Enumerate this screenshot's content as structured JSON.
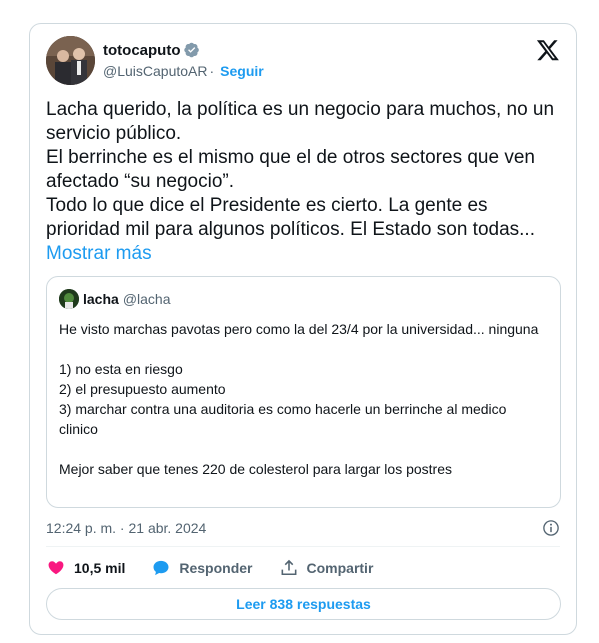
{
  "author": {
    "display_name": "totocaputo",
    "handle": "@LuisCaputoAR",
    "separator": "·",
    "follow_label": "Seguir"
  },
  "tweet": {
    "text": "Lacha querido, la política es un negocio para muchos, no un servicio público.\nEl berrinche es el mismo que el de otros sectores que ven afectado “su negocio”.\nTodo lo que dice el Presidente es cierto. La gente es prioridad mil para algunos políticos. El Estado son todas...",
    "more_label": " Mostrar más"
  },
  "quote": {
    "name": "lacha",
    "handle": "@lacha",
    "text": "He visto marchas pavotas pero como la del 23/4 por la universidad... ninguna\n\n1) no esta en riesgo\n2) el presupuesto aumento\n3) marchar contra una auditoria es como hacerle un berrinche al medico clinico\n\nMejor saber que tenes 220 de colesterol para largar los postres"
  },
  "meta": {
    "timestamp": "12:24 p. m. · 21 abr. 2024"
  },
  "actions": {
    "like_count": "10,5 mil",
    "reply_label": "Responder",
    "share_label": "Compartir"
  },
  "replies_button": {
    "label": "Leer 838 respuestas"
  },
  "colors": {
    "accent": "#1d9bf0",
    "like": "#f91880",
    "secondary_text": "#536471",
    "border": "#cfd9de"
  },
  "icons": [
    "verified-badge-icon",
    "x-logo-icon",
    "info-icon",
    "heart-icon",
    "reply-bubble-icon",
    "share-icon"
  ]
}
